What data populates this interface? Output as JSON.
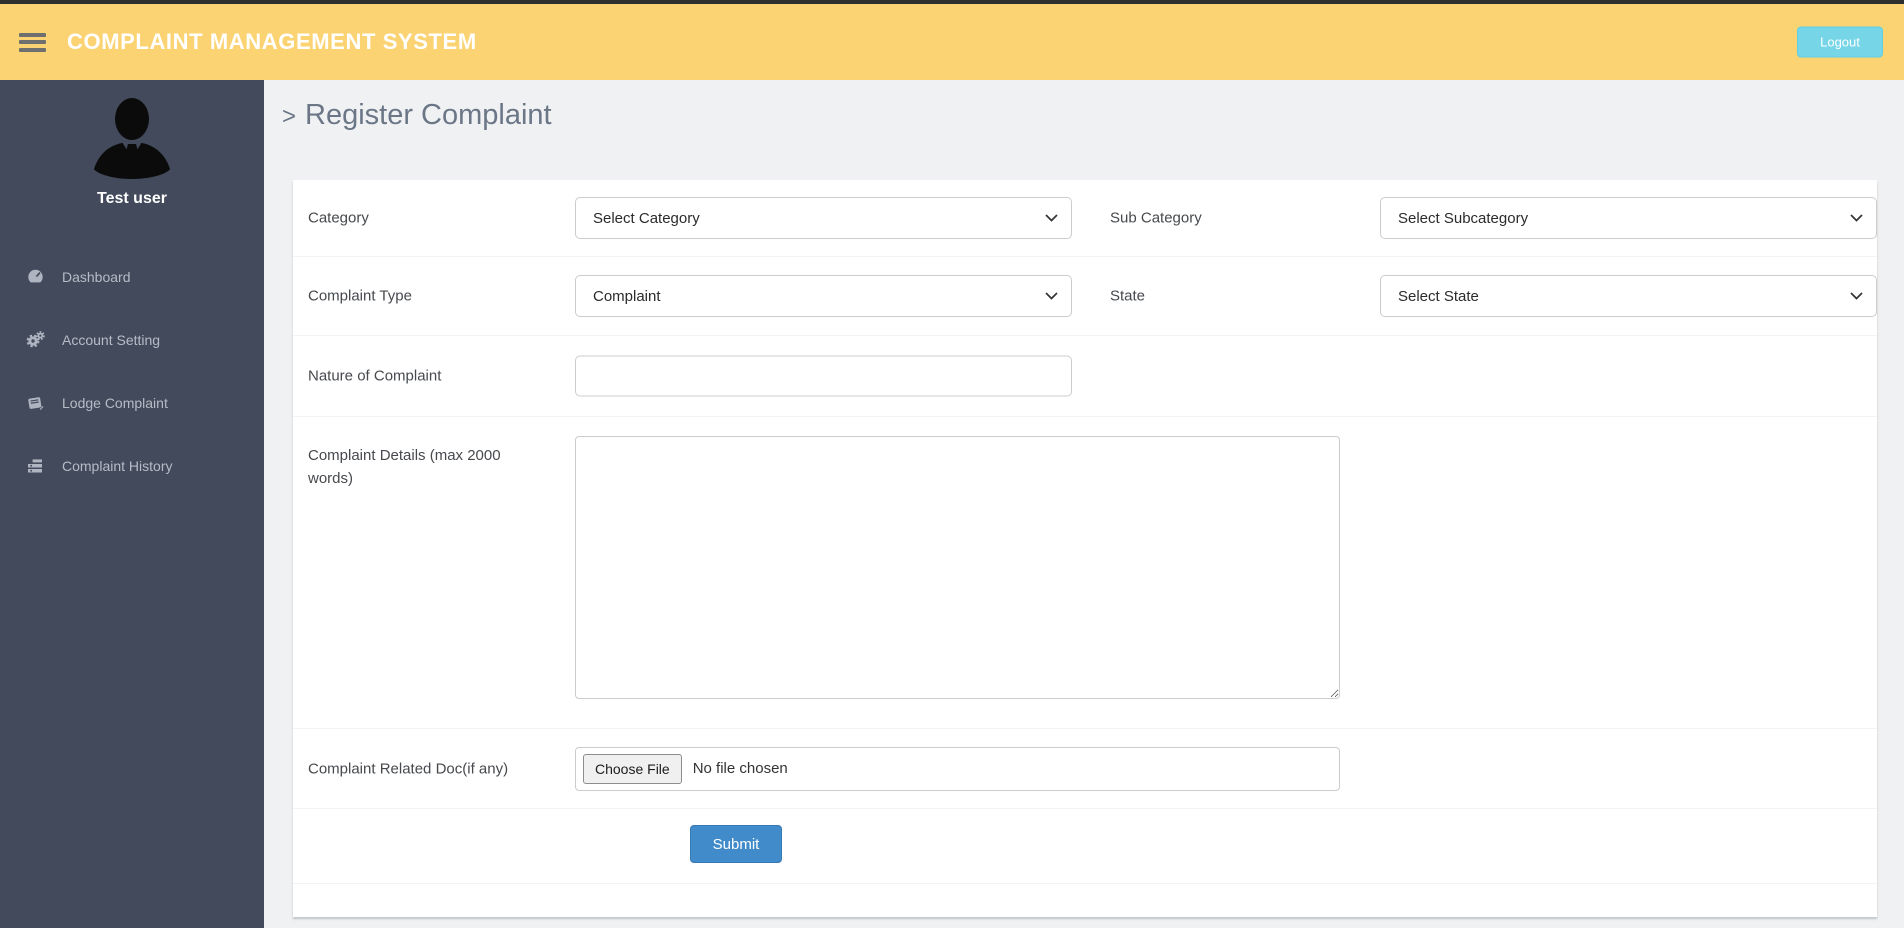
{
  "header": {
    "title": "COMPLAINT MANAGEMENT SYSTEM",
    "logout_label": "Logout",
    "colors": {
      "bar": "#fcd373",
      "logout": "#76d6e8",
      "top_strip": "#2f2f2f"
    }
  },
  "sidebar": {
    "username": "Test user",
    "bg_color": "#424a5b",
    "items": [
      {
        "label": "Dashboard",
        "icon": "dashboard-icon"
      },
      {
        "label": "Account Setting",
        "icon": "gears-icon"
      },
      {
        "label": "Lodge Complaint",
        "icon": "book-icon"
      },
      {
        "label": "Complaint History",
        "icon": "list-icon"
      }
    ]
  },
  "page": {
    "breadcrumb_chevron": ">",
    "title": "Register Complaint"
  },
  "form": {
    "fields": {
      "category": {
        "label": "Category",
        "value": "Select Category"
      },
      "sub_category": {
        "label": "Sub Category",
        "value": "Select Subcategory"
      },
      "complaint_type": {
        "label": "Complaint Type",
        "value": "Complaint"
      },
      "state": {
        "label": "State",
        "value": "Select State"
      },
      "nature": {
        "label": "Nature of Complaint",
        "value": ""
      },
      "details": {
        "label": "Complaint Details (max 2000 words)",
        "value": ""
      },
      "doc": {
        "label": "Complaint Related Doc(if any)",
        "button_label": "Choose File",
        "status_text": "No file chosen"
      }
    },
    "submit_label": "Submit",
    "submit_color": "#428bca"
  }
}
